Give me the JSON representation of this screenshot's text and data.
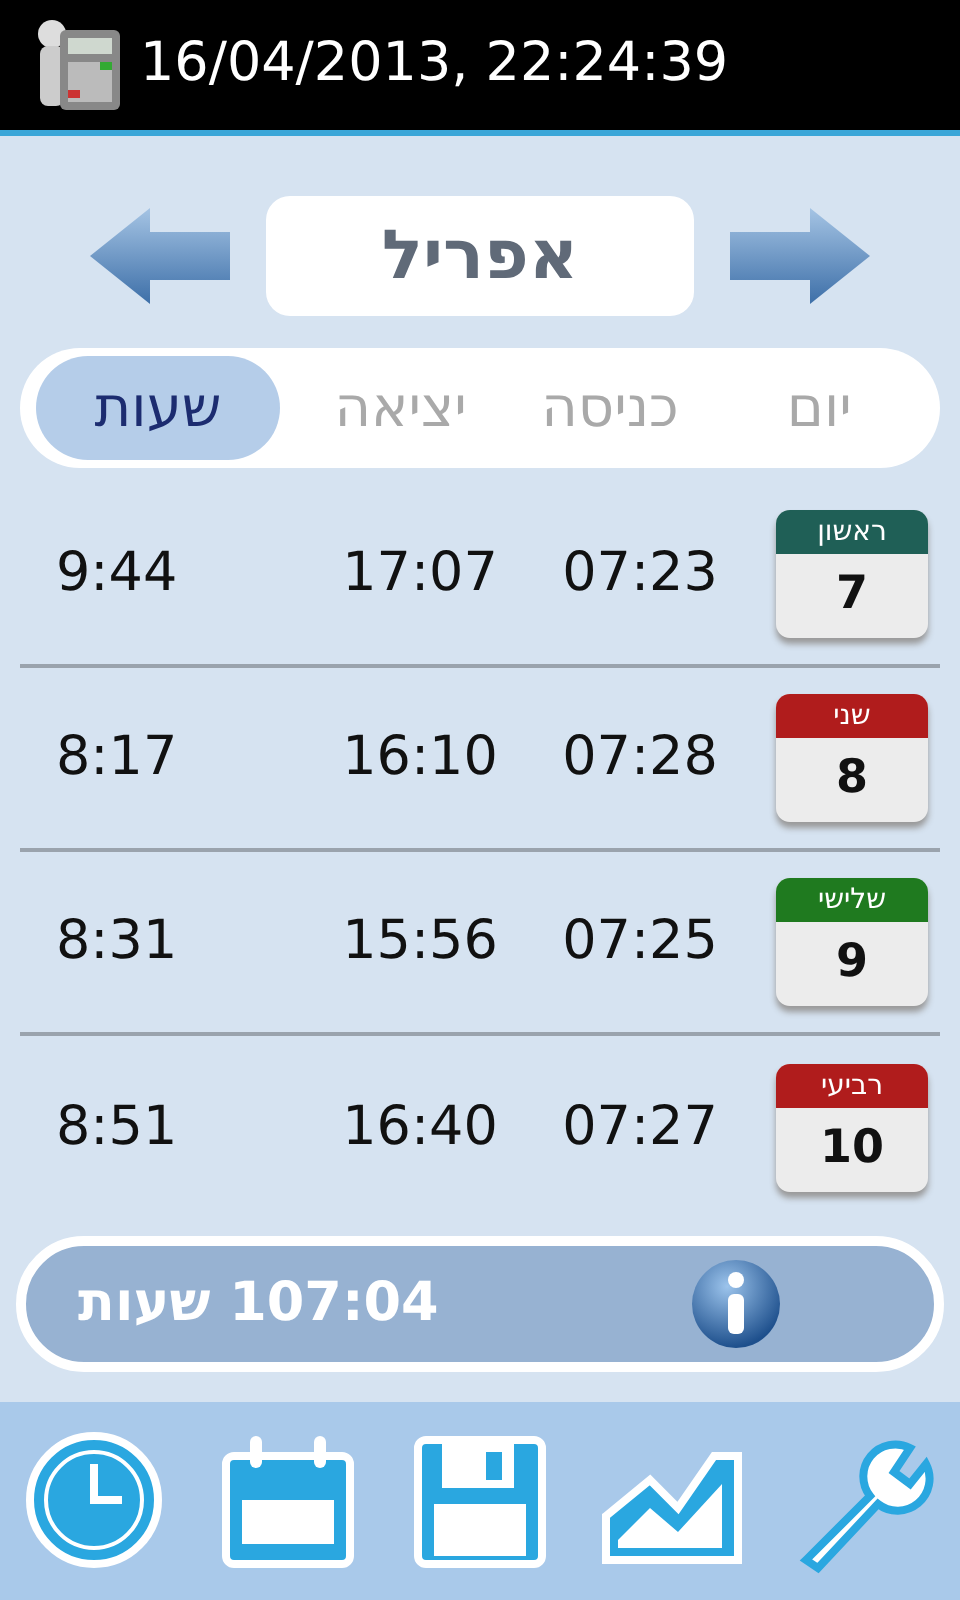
{
  "status_bar": {
    "datetime": "16/04/2013, 22:24:39"
  },
  "month_nav": {
    "month": "אפריל"
  },
  "tabs": [
    {
      "label": "יום",
      "selected": false
    },
    {
      "label": "כניסה",
      "selected": false
    },
    {
      "label": "יציאה",
      "selected": false
    },
    {
      "label": "שעות",
      "selected": true
    }
  ],
  "rows": [
    {
      "weekday": "ראשון",
      "day": "7",
      "color": "#1f5f56",
      "entry": "07:23",
      "exit": "17:07",
      "hours": "9:44"
    },
    {
      "weekday": "שני",
      "day": "8",
      "color": "#b01c1c",
      "entry": "07:28",
      "exit": "16:10",
      "hours": "8:17"
    },
    {
      "weekday": "שלישי",
      "day": "9",
      "color": "#1f7a1f",
      "entry": "07:25",
      "exit": "15:56",
      "hours": "8:31"
    },
    {
      "weekday": "רביעי",
      "day": "10",
      "color": "#b01c1c",
      "entry": "07:27",
      "exit": "16:40",
      "hours": "8:51"
    }
  ],
  "total": {
    "text": "107:04 שעות"
  },
  "toolbar": [
    {
      "kind": "clock"
    },
    {
      "kind": "calendar"
    },
    {
      "kind": "save"
    },
    {
      "kind": "chart"
    },
    {
      "kind": "settings"
    }
  ]
}
